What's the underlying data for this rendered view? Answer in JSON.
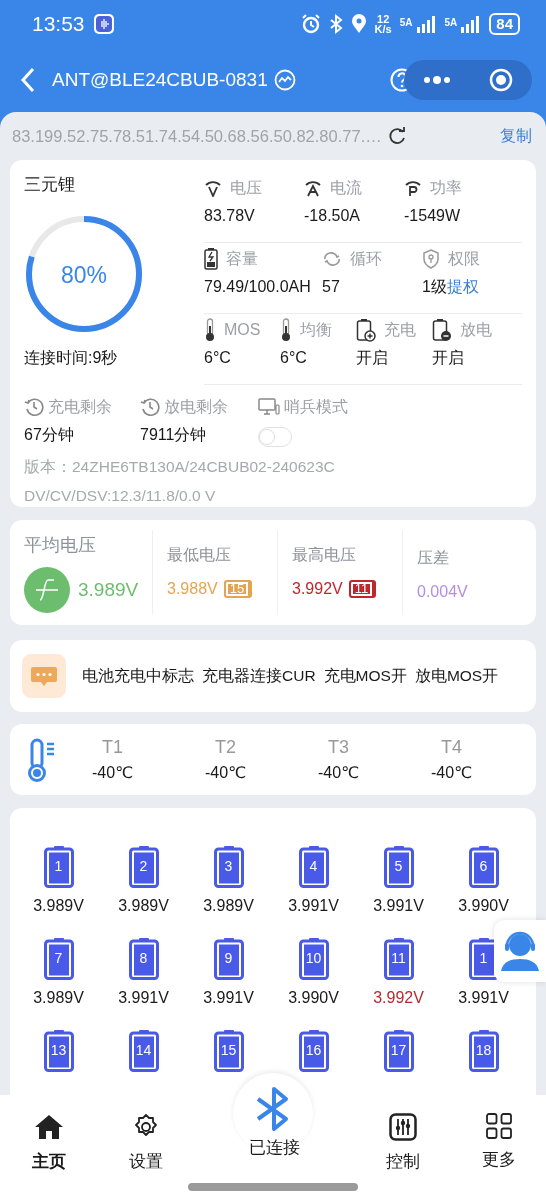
{
  "status_bar": {
    "time": "13:53",
    "net_speed": "12",
    "net_speed_unit": "K/s",
    "signal_1": "5A",
    "signal_2": "5A",
    "battery": "84"
  },
  "header": {
    "title": "ANT@BLE24CBUB-0831"
  },
  "id_bar": {
    "text": "83.199.52.75.78.51.74.54.50.68.56.50.82.80.77.…",
    "copy_label": "复制"
  },
  "summary": {
    "chemistry": "三元锂",
    "soc_text": "80%",
    "level": 0.8,
    "connected_time": "连接时间:9秒",
    "metric_rows": [
      [
        {
          "kind": "voltage",
          "label": "电压",
          "value": "83.78V"
        },
        {
          "kind": "current",
          "label": "电流",
          "value": "-18.50A"
        },
        {
          "kind": "power",
          "label": "功率",
          "value": "-1549W"
        }
      ],
      [
        {
          "kind": "capacity",
          "label": "容量",
          "value": "79.49/100.0AH"
        },
        {
          "kind": "cycle",
          "label": "循环",
          "value": "57"
        },
        {
          "kind": "permission",
          "label": "权限",
          "value": "1级",
          "link": "提权"
        }
      ],
      [
        {
          "kind": "temp",
          "label": "MOS",
          "value": "6°C"
        },
        {
          "kind": "temp",
          "label": "均衡",
          "value": "6°C"
        },
        {
          "kind": "charge",
          "label": "充电",
          "value": "开启"
        },
        {
          "kind": "discharge",
          "label": "放电",
          "value": "开启"
        }
      ]
    ],
    "remain": [
      {
        "kind": "time",
        "label": "充电剩余",
        "value": "67分钟"
      },
      {
        "kind": "time",
        "label": "放电剩余",
        "value": "7911分钟"
      },
      {
        "kind": "toggle",
        "label": "哨兵模式",
        "on": false
      }
    ],
    "version": "版本：24ZHE6TB130A/24CBUB02-240623C",
    "dv_line": "DV/CV/DSV:12.3/11.8/0.0 V"
  },
  "voltage_stats": [
    {
      "kind": "avg",
      "label": "平均电压",
      "value": "3.989V",
      "color": "#6dbd6f"
    },
    {
      "kind": "min",
      "label": "最低电压",
      "value": "3.988V",
      "cell": "15",
      "color": "#e4a550"
    },
    {
      "kind": "max",
      "label": "最高电压",
      "value": "3.992V",
      "cell": "11",
      "color": "#c0262d"
    },
    {
      "kind": "diff",
      "label": "压差",
      "value": "0.004V",
      "color": "#b58ee3"
    }
  ],
  "flags": [
    "电池充电中标志",
    "充电器连接CUR",
    "充电MOS开",
    "放电MOS开"
  ],
  "temperatures": [
    {
      "label": "T1",
      "value": "-40℃"
    },
    {
      "label": "T2",
      "value": "-40℃"
    },
    {
      "label": "T3",
      "value": "-40℃"
    },
    {
      "label": "T4",
      "value": "-40℃"
    }
  ],
  "cells": [
    {
      "number": "1",
      "voltage": "3.989V",
      "is_max": false
    },
    {
      "number": "2",
      "voltage": "3.989V",
      "is_max": false
    },
    {
      "number": "3",
      "voltage": "3.989V",
      "is_max": false
    },
    {
      "number": "4",
      "voltage": "3.991V",
      "is_max": false
    },
    {
      "number": "5",
      "voltage": "3.991V",
      "is_max": false
    },
    {
      "number": "6",
      "voltage": "3.990V",
      "is_max": false
    },
    {
      "number": "7",
      "voltage": "3.989V",
      "is_max": false
    },
    {
      "number": "8",
      "voltage": "3.991V",
      "is_max": false
    },
    {
      "number": "9",
      "voltage": "3.991V",
      "is_max": false
    },
    {
      "number": "10",
      "voltage": "3.990V",
      "is_max": false
    },
    {
      "number": "11",
      "voltage": "3.992V",
      "is_max": true
    },
    {
      "number": "1",
      "voltage": "3.991V",
      "is_max": false
    },
    {
      "number": "13"
    },
    {
      "number": "14"
    },
    {
      "number": "15"
    },
    {
      "number": "16"
    },
    {
      "number": "17"
    },
    {
      "number": "18"
    }
  ],
  "bottom_nav": [
    {
      "kind": "home",
      "label": "主页",
      "selected": true
    },
    {
      "kind": "settings",
      "label": "设置",
      "selected": false
    },
    {
      "kind": "bluetooth",
      "label": "已连接",
      "selected": false
    },
    {
      "kind": "control",
      "label": "控制",
      "selected": false
    },
    {
      "kind": "more",
      "label": "更多",
      "selected": false
    }
  ]
}
